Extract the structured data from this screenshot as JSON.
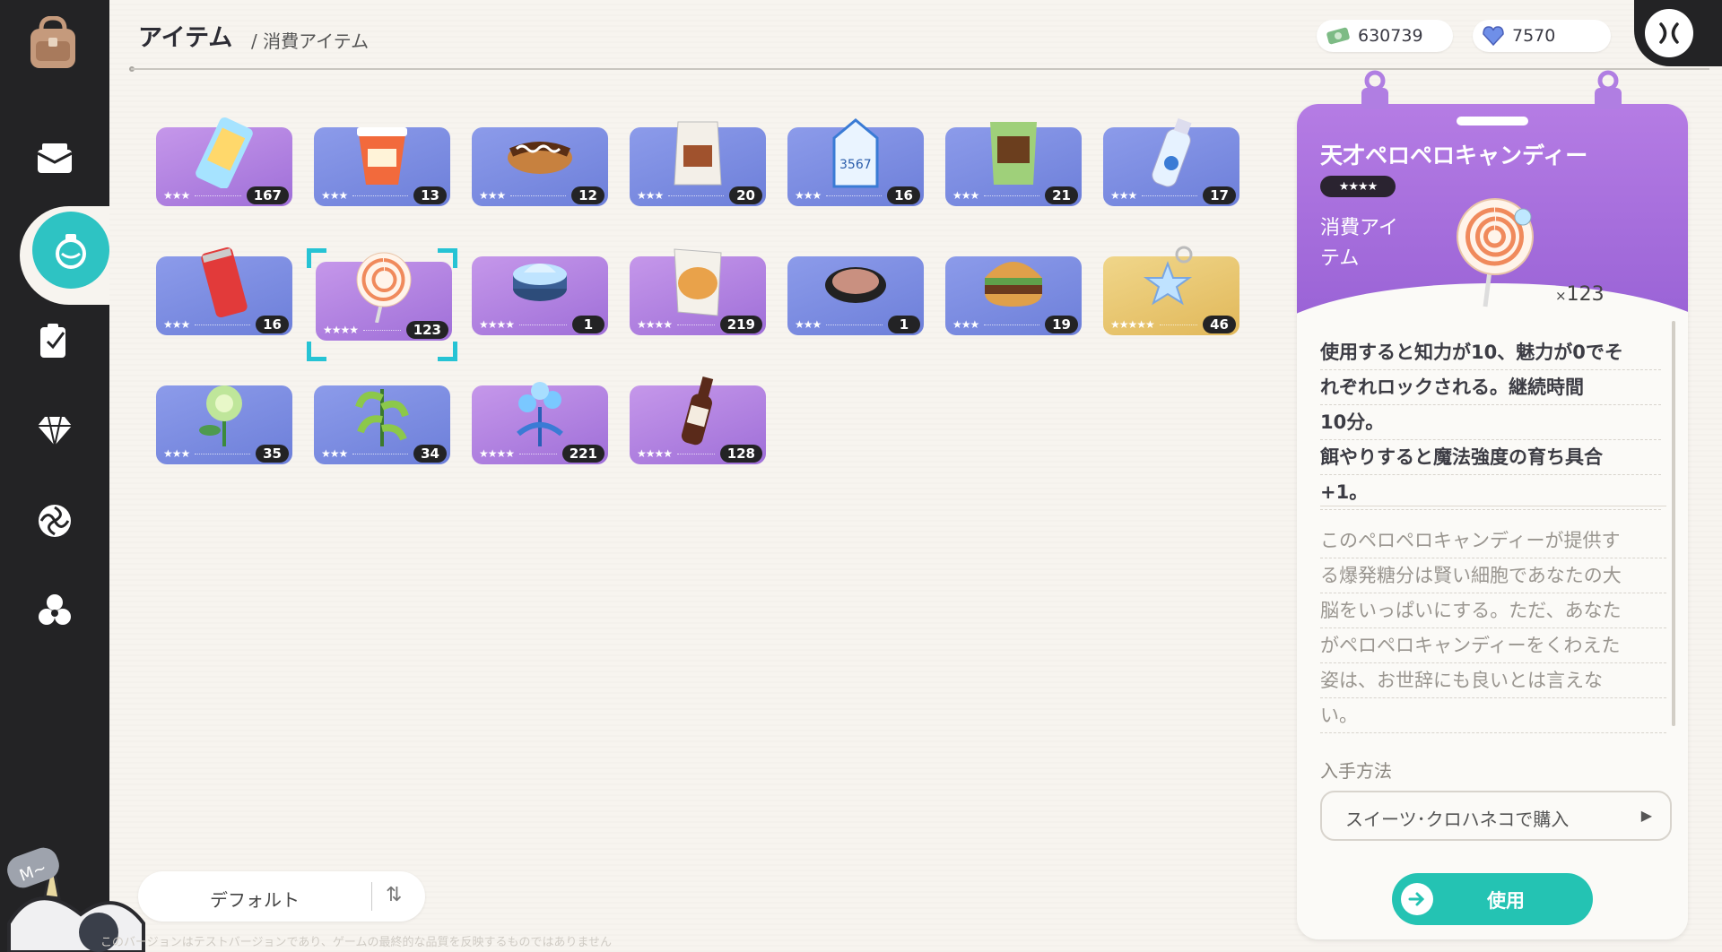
{
  "header": {
    "title": "アイテム",
    "subtitle": "/ 消費アイテム"
  },
  "currency": {
    "money": "630739",
    "gems": "7570"
  },
  "items": [
    {
      "name": "popsicle",
      "rarity": 3,
      "stars": "★★★",
      "count": "167",
      "color": "r4"
    },
    {
      "name": "cup-noodle",
      "rarity": 3,
      "stars": "★★★",
      "count": "13",
      "color": "r3"
    },
    {
      "name": "eclair",
      "rarity": 3,
      "stars": "★★★",
      "count": "12",
      "color": "r3"
    },
    {
      "name": "snack-bag",
      "rarity": 3,
      "stars": "★★★",
      "count": "20",
      "color": "r3"
    },
    {
      "name": "milk-carton",
      "rarity": 3,
      "stars": "★★★",
      "count": "16",
      "color": "r3"
    },
    {
      "name": "green-bag",
      "rarity": 3,
      "stars": "★★★",
      "count": "21",
      "color": "r3"
    },
    {
      "name": "water-bottle",
      "rarity": 3,
      "stars": "★★★",
      "count": "17",
      "color": "r3"
    },
    {
      "name": "soda-can",
      "rarity": 3,
      "stars": "★★★",
      "count": "16",
      "color": "r3"
    },
    {
      "name": "lollipop",
      "rarity": 4,
      "stars": "★★★★",
      "count": "123",
      "color": "r4",
      "selected": true
    },
    {
      "name": "cream-jar",
      "rarity": 4,
      "stars": "★★★★",
      "count": "1",
      "color": "r4"
    },
    {
      "name": "bread-pack",
      "rarity": 4,
      "stars": "★★★★",
      "count": "219",
      "color": "r4"
    },
    {
      "name": "compact",
      "rarity": 3,
      "stars": "★★★",
      "count": "1",
      "color": "r3"
    },
    {
      "name": "burger",
      "rarity": 3,
      "stars": "★★★",
      "count": "19",
      "color": "r3"
    },
    {
      "name": "star-keychain",
      "rarity": 5,
      "stars": "★★★★★",
      "count": "46",
      "color": "r5"
    },
    {
      "name": "green-flower",
      "rarity": 3,
      "stars": "★★★",
      "count": "35",
      "color": "r3"
    },
    {
      "name": "herb",
      "rarity": 3,
      "stars": "★★★",
      "count": "34",
      "color": "r3"
    },
    {
      "name": "blue-flower",
      "rarity": 4,
      "stars": "★★★★",
      "count": "221",
      "color": "r4"
    },
    {
      "name": "bottle",
      "rarity": 4,
      "stars": "★★★★",
      "count": "128",
      "color": "r4"
    }
  ],
  "sort": {
    "label": "デフォルト",
    "icon": "⇅"
  },
  "disclaimer": "このバージョンはテストバージョンであり、ゲームの最終的な品質を反映するものではありません",
  "detail": {
    "name": "天才ペロペロキャンディー",
    "stars": "★★★★",
    "type_line1": "消費アイ",
    "type_line2": "テム",
    "owned_prefix": "×",
    "owned_count": "123",
    "effect_lines": [
      "使用すると知力が10、魅力が0でそ",
      "れぞれロックされる。継続時間",
      "10分。",
      "餌やりすると魔法強度の育ち具合",
      "+1。"
    ],
    "flavor_lines": [
      "このペロペロキャンディーが提供す",
      "る爆発糖分は賢い細胞であなたの大",
      "脳をいっぱいにする。ただ、あなた",
      "がペロペロキャンディーをくわえた",
      "姿は、お世辞にも良いとは言えな",
      "い。"
    ],
    "obtain_label": "入手方法",
    "obtain_source": "スイーツ･クロハネコで購入",
    "use_label": "使用"
  },
  "colors": {
    "sidebar": "#232325",
    "accent": "#2ec3c3",
    "rare3": "#7d8ee2",
    "rare4": "#b07ee2",
    "rare5": "#e8c872"
  }
}
